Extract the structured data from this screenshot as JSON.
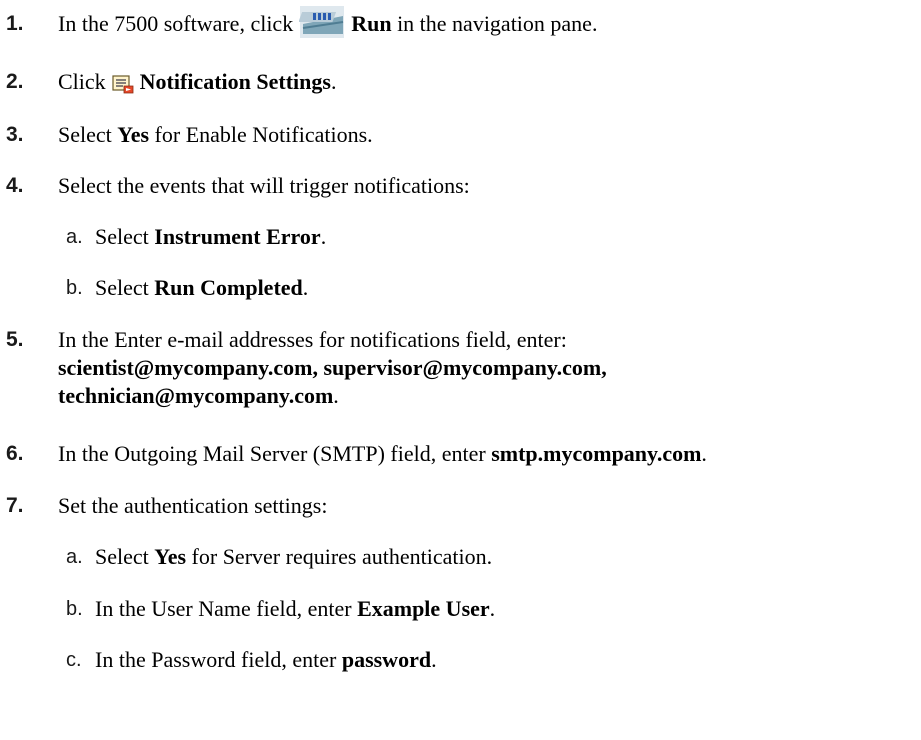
{
  "steps": [
    {
      "num": "1.",
      "pre": "In the 7500 software, click",
      "bold": "Run",
      "post": "in the navigation pane.",
      "icon": "run-icon"
    },
    {
      "num": "2.",
      "pre": "Click",
      "bold": "Notification Settings",
      "post": ".",
      "icon": "notification-settings-icon"
    },
    {
      "num": "3.",
      "pre": "Select ",
      "bold": "Yes",
      "post": " for Enable Notifications."
    },
    {
      "num": "4.",
      "pre": "Select the events that will trigger notifications:",
      "bold": "",
      "post": ""
    },
    {
      "num": "a.",
      "pre": "Select ",
      "bold": "Instrument Error",
      "post": "."
    },
    {
      "num": "b.",
      "pre": "Select ",
      "bold": "Run Completed",
      "post": "."
    },
    {
      "num": "5.",
      "line1": "In the Enter e-mail addresses for notifications field, enter:",
      "line2": "scientist@mycompany.com, supervisor@mycompany.com,",
      "line3": "technician@mycompany.com",
      "line3_post": "."
    },
    {
      "num": "6.",
      "pre": "In the Outgoing Mail Server (SMTP) field, enter ",
      "bold": "smtp.mycompany.com",
      "post": "."
    },
    {
      "num": "7.",
      "pre": "Set the authentication settings:",
      "bold": "",
      "post": ""
    },
    {
      "num": "a.",
      "pre": "Select ",
      "bold": "Yes",
      "post": " for Server requires authentication."
    },
    {
      "num": "b.",
      "pre": "In the User Name field, enter ",
      "bold": "Example User",
      "post": "."
    },
    {
      "num": "c.",
      "pre": "In the Password field, enter ",
      "bold": "password",
      "post": "."
    }
  ]
}
